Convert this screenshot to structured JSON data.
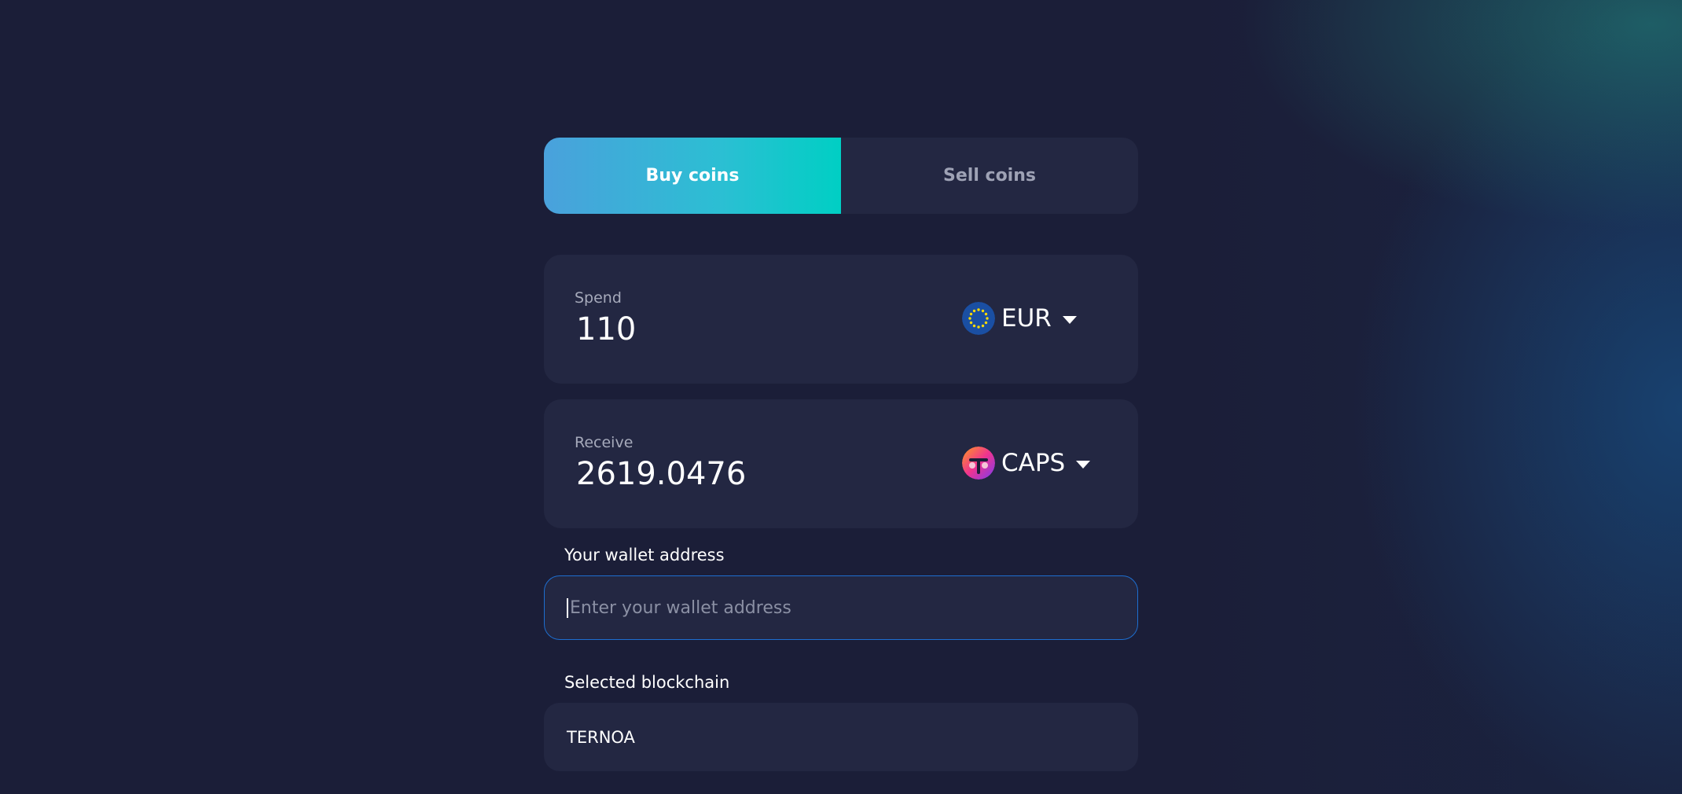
{
  "tabs": {
    "buy_label": "Buy coins",
    "sell_label": "Sell coins",
    "active": "buy"
  },
  "spend": {
    "label": "Spend",
    "value": "110",
    "currency": "EUR",
    "currency_icon": "eu-flag-icon"
  },
  "receive": {
    "label": "Receive",
    "value": "2619.0476",
    "currency": "CAPS",
    "currency_icon": "caps-token-icon"
  },
  "wallet": {
    "label": "Your wallet address",
    "placeholder": "Enter your wallet address",
    "value": ""
  },
  "blockchain": {
    "label": "Selected blockchain",
    "value": "TERNOA"
  },
  "colors": {
    "background": "#1b1e38",
    "card": "#232742",
    "accent_start": "#4aa1dc",
    "accent_end": "#00cfc4",
    "focus_border": "#1d6ed0"
  }
}
